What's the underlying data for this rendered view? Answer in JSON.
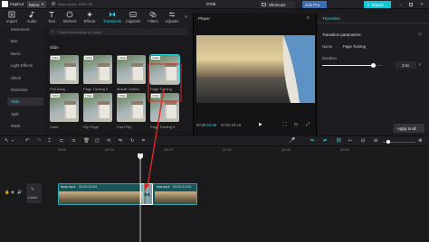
{
  "titlebar": {
    "app_name": "CapCut",
    "menu_label": "Menu",
    "auto_save": "Auto saved: 18:57:06",
    "project_name": "0705",
    "shortcuts_label": "Shortcuts",
    "join_pro_label": "Join Pro",
    "export_label": "Export"
  },
  "toolbar": {
    "tools": [
      {
        "label": "Import",
        "icon": "import-icon"
      },
      {
        "label": "Audio",
        "icon": "audio-icon"
      },
      {
        "label": "Text",
        "icon": "text-icon"
      },
      {
        "label": "Stickers",
        "icon": "stickers-icon"
      },
      {
        "label": "Effects",
        "icon": "effects-icon"
      },
      {
        "label": "Transitions",
        "icon": "transitions-icon"
      },
      {
        "label": "Captions",
        "icon": "captions-icon"
      },
      {
        "label": "Filters",
        "icon": "filters-icon"
      },
      {
        "label": "Adjustm",
        "icon": "adjustment-icon"
      }
    ],
    "active_tool": "Transitions"
  },
  "leftnav": {
    "items": [
      "Movement",
      "Blur",
      "Basic",
      "Light Effects",
      "Glitch",
      "Distortion",
      "Slide",
      "Split",
      "Mask"
    ],
    "active": "Slide"
  },
  "search": {
    "placeholder": "Search transitions by name"
  },
  "transitions": {
    "section_title": "Slide",
    "badge": "FREE",
    "items": [
      "Pull Away",
      "Page Turning II",
      "Mobile Switch",
      "Page Turning",
      "Cube",
      "Flip Page",
      "Card Flip",
      "Page Turning 3"
    ],
    "selected": "Page Turning"
  },
  "player": {
    "title": "Player",
    "timecode_current": "00:00:24:09",
    "timecode_total": "00:00:39:18"
  },
  "props": {
    "panel_title": "Transition",
    "section_title": "Transition parameters",
    "name_label": "Name",
    "name_value": "Page Turning",
    "duration_label": "Duration",
    "duration_value": "3.5s",
    "duration_fraction": 0.85,
    "apply_all_label": "Apply to all"
  },
  "timeline": {
    "ruler": [
      "00:00",
      "|00:10",
      "|00:20",
      "|00:30",
      "|00:40",
      "|00:50"
    ],
    "clip_a": {
      "name": "dusk.mp4",
      "duration": "00:00:25:09"
    },
    "clip_b": {
      "name": "sea.mp4",
      "duration": "00:00:14:10"
    },
    "cover_label": "Cover"
  }
}
